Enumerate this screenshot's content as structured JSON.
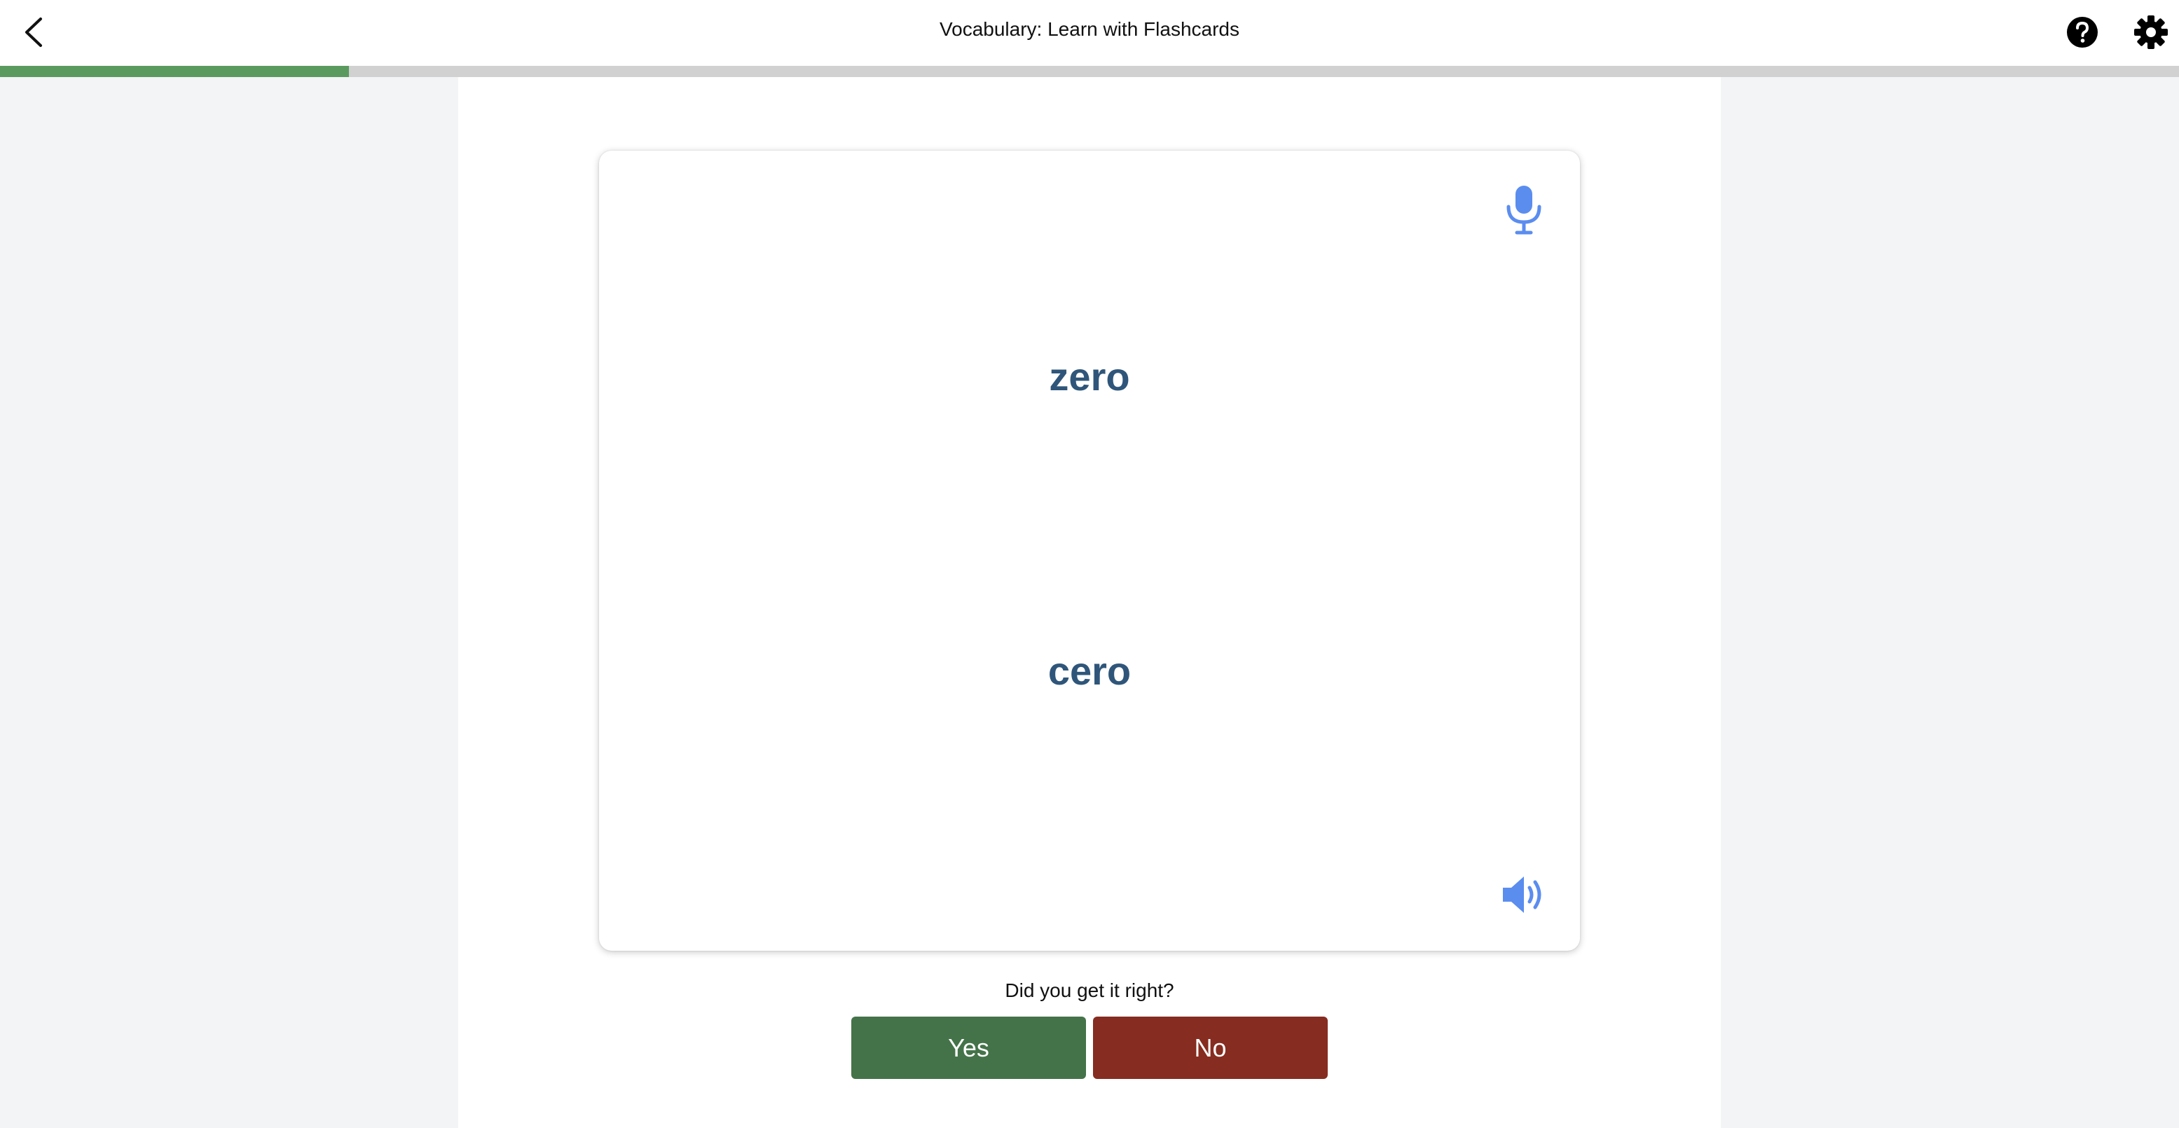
{
  "header": {
    "title": "Vocabulary: Learn with Flashcards",
    "back_icon": "chevron-left-icon",
    "help_icon": "question-circle-icon",
    "settings_icon": "gear-icon"
  },
  "progress": {
    "fraction": 0.16,
    "fill_color": "#5a9a5e",
    "track_color": "#d1d1d1"
  },
  "card": {
    "front_term": "zero",
    "back_term": "cero",
    "text_color": "#2f567a",
    "mic_icon": "microphone-icon",
    "speaker_icon": "speaker-volume-icon",
    "icon_color": "#5b8def"
  },
  "feedback": {
    "question": "Did you get it right?",
    "yes_label": "Yes",
    "no_label": "No",
    "yes_color": "#447349",
    "no_color": "#862c20"
  }
}
